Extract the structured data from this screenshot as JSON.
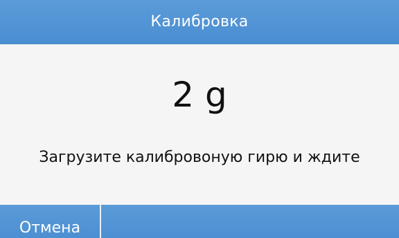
{
  "header": {
    "title": "Калибровка"
  },
  "main": {
    "weight_display": "2 g",
    "instruction": "Загрузите калибровоную гирю и ждите"
  },
  "footer": {
    "cancel_label": "Отмена"
  },
  "colors": {
    "bar_blue": "#4f92d4",
    "background": "#f5f5f5",
    "text": "#111111"
  }
}
